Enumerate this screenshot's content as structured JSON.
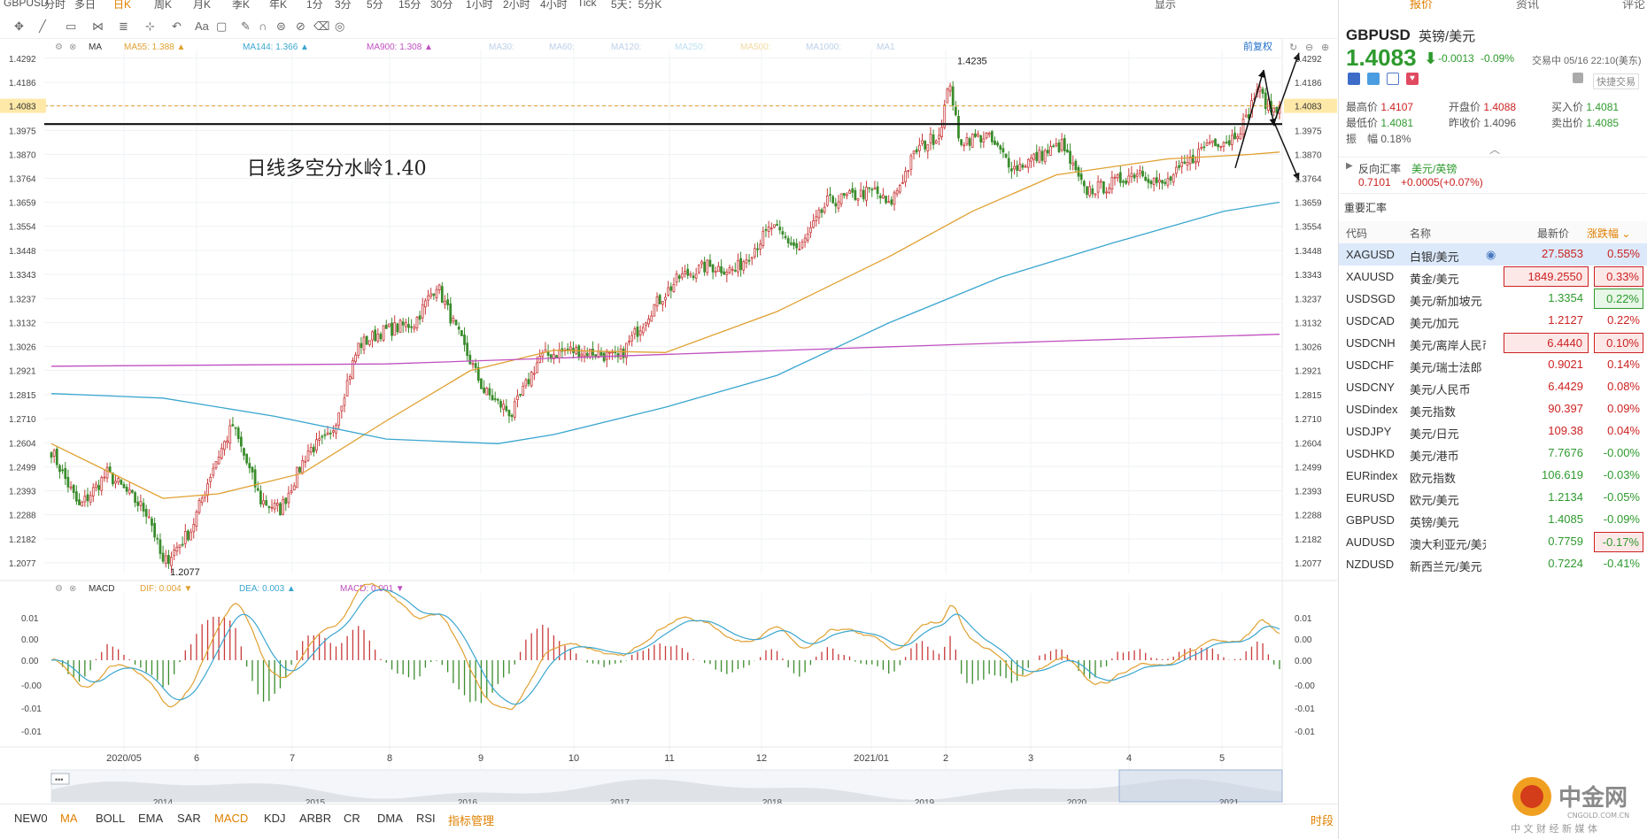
{
  "topbar": {
    "items": [
      "GBPUSD",
      "分时",
      "多日",
      "日K",
      "周K",
      "月K",
      "季K",
      "年K",
      "1分",
      "3分",
      "5分",
      "15分",
      "30分",
      "1小时",
      "2小时",
      "4小时",
      "Tick",
      "5天：5分K"
    ],
    "active_index": 3,
    "right": [
      "显示"
    ]
  },
  "ma_legend": {
    "label": "MA",
    "items": [
      {
        "text": "MA55: 1.388",
        "color": "#e0a030",
        "arrow": "▲"
      },
      {
        "text": "MA144: 1.366",
        "color": "#3aa6cf",
        "arrow": "▲"
      },
      {
        "text": "MA900: 1.308",
        "color": "#c050c0",
        "arrow": "▲"
      },
      {
        "text": "MA30:",
        "color": "#bcd0e8",
        "arrow": ""
      },
      {
        "text": "MA60:",
        "color": "#bcd0e8",
        "arrow": ""
      },
      {
        "text": "MA120:",
        "color": "#bcd0e8",
        "arrow": ""
      },
      {
        "text": "MA250:",
        "color": "#bde0f0",
        "arrow": ""
      },
      {
        "text": "MA500:",
        "color": "#f2d9a0",
        "arrow": ""
      },
      {
        "text": "MA1000:",
        "color": "#bcd0e8",
        "arrow": ""
      },
      {
        "text": "MA1",
        "color": "#bcd0e8",
        "arrow": ""
      }
    ],
    "adjust": "前复权"
  },
  "macd_legend": {
    "label": "MACD",
    "dif": "DIF: 0.004",
    "dea": "DEA: 0.003",
    "macd": "MACD: 0.001",
    "dif_arrow": "▼",
    "dea_arrow": "▲",
    "macd_arrow": "▼"
  },
  "chart_data": {
    "type": "candlestick",
    "symbol": "GBPUSD",
    "ylim": [
      1.203,
      1.433
    ],
    "y_ticks": [
      "1.4292",
      "1.4186",
      "1.4083",
      "1.3975",
      "1.3870",
      "1.3764",
      "1.3659",
      "1.3554",
      "1.3448",
      "1.3343",
      "1.3237",
      "1.3132",
      "1.3026",
      "1.2921",
      "1.2815",
      "1.2710",
      "1.2604",
      "1.2499",
      "1.2393",
      "1.2288",
      "1.2182",
      "1.2077"
    ],
    "x_ticks": [
      "2020/05",
      "6",
      "7",
      "8",
      "9",
      "10",
      "11",
      "12",
      "2021/01",
      "2",
      "3",
      "4",
      "5"
    ],
    "anchors": [
      [
        0,
        1.257
      ],
      [
        10,
        1.232
      ],
      [
        20,
        1.247
      ],
      [
        35,
        1.229
      ],
      [
        40,
        1.207
      ],
      [
        50,
        1.222
      ],
      [
        58,
        1.25
      ],
      [
        65,
        1.268
      ],
      [
        75,
        1.235
      ],
      [
        82,
        1.231
      ],
      [
        92,
        1.257
      ],
      [
        100,
        1.263
      ],
      [
        110,
        1.303
      ],
      [
        118,
        1.309
      ],
      [
        130,
        1.313
      ],
      [
        138,
        1.33
      ],
      [
        145,
        1.31
      ],
      [
        155,
        1.283
      ],
      [
        165,
        1.273
      ],
      [
        175,
        1.298
      ],
      [
        185,
        1.301
      ],
      [
        195,
        1.3
      ],
      [
        203,
        1.297
      ],
      [
        215,
        1.319
      ],
      [
        225,
        1.333
      ],
      [
        235,
        1.338
      ],
      [
        245,
        1.336
      ],
      [
        258,
        1.355
      ],
      [
        268,
        1.345
      ],
      [
        278,
        1.366
      ],
      [
        285,
        1.368
      ],
      [
        295,
        1.371
      ],
      [
        300,
        1.364
      ],
      [
        310,
        1.389
      ],
      [
        318,
        1.396
      ],
      [
        322,
        1.419
      ],
      [
        325,
        1.393
      ],
      [
        335,
        1.395
      ],
      [
        345,
        1.381
      ],
      [
        355,
        1.387
      ],
      [
        362,
        1.391
      ],
      [
        370,
        1.371
      ],
      [
        378,
        1.373
      ],
      [
        390,
        1.38
      ],
      [
        398,
        1.373
      ],
      [
        408,
        1.384
      ],
      [
        415,
        1.393
      ],
      [
        422,
        1.393
      ],
      [
        428,
        1.402
      ],
      [
        432,
        1.416
      ],
      [
        436,
        1.408
      ],
      [
        440,
        1.405
      ]
    ],
    "ma_series": [
      {
        "name": "MA55",
        "color": "#e0a030",
        "pts": [
          [
            0,
            1.26
          ],
          [
            40,
            1.236
          ],
          [
            60,
            1.238
          ],
          [
            90,
            1.247
          ],
          [
            120,
            1.27
          ],
          [
            150,
            1.292
          ],
          [
            180,
            1.301
          ],
          [
            220,
            1.3
          ],
          [
            260,
            1.318
          ],
          [
            300,
            1.342
          ],
          [
            330,
            1.362
          ],
          [
            360,
            1.378
          ],
          [
            400,
            1.385
          ],
          [
            430,
            1.387
          ],
          [
            440,
            1.388
          ]
        ]
      },
      {
        "name": "MA144",
        "color": "#3aa6cf",
        "pts": [
          [
            0,
            1.282
          ],
          [
            40,
            1.28
          ],
          [
            80,
            1.272
          ],
          [
            120,
            1.262
          ],
          [
            160,
            1.26
          ],
          [
            180,
            1.264
          ],
          [
            220,
            1.276
          ],
          [
            260,
            1.29
          ],
          [
            300,
            1.313
          ],
          [
            340,
            1.333
          ],
          [
            380,
            1.348
          ],
          [
            420,
            1.362
          ],
          [
            440,
            1.366
          ]
        ]
      },
      {
        "name": "MA900",
        "color": "#c050c0",
        "pts": [
          [
            0,
            1.294
          ],
          [
            120,
            1.295
          ],
          [
            240,
            1.3
          ],
          [
            360,
            1.305
          ],
          [
            440,
            1.308
          ]
        ]
      }
    ],
    "annotations": [
      {
        "text": "1.4235",
        "at": [
          322,
          1.4235
        ]
      },
      {
        "text": "1.2077",
        "at": [
          40,
          1.2077
        ]
      },
      {
        "text": "日线多空分水岭1.40",
        "at": [
          70,
          1.378
        ]
      }
    ],
    "current_price": 1.4083,
    "key_level": 1.4003,
    "macd": {
      "y_ticks": [
        "0.01",
        "0.00",
        "0.00",
        "-0.00",
        "-0.01",
        "-0.01"
      ],
      "ylim": [
        -0.012,
        0.012
      ]
    },
    "navigator_years": [
      "2014",
      "2015",
      "2016",
      "2017",
      "2018",
      "2019",
      "2020",
      "2021"
    ]
  },
  "indicators": [
    "NEW0",
    "MA",
    "BOLL",
    "EMA",
    "SAR",
    "MACD",
    "KDJ",
    "ARBR",
    "CR",
    "DMA",
    "RSI",
    "指标管理"
  ],
  "indicators_active": [
    "MA",
    "MACD"
  ],
  "indicator_right": "时段",
  "panel": {
    "tabs": [
      "报价",
      "资讯",
      "评论"
    ],
    "symbol": "GBPUSD",
    "name": "英镑/美元",
    "price": "1.4083",
    "change": "-0.0013",
    "change_pct": "-0.09%",
    "status": "交易中 05/16 22:10(美东)",
    "quick_trade": "快捷交易",
    "stats": [
      {
        "label": "最高价",
        "value": "1.4107",
        "cls": "pos"
      },
      {
        "label": "开盘价",
        "value": "1.4088",
        "cls": "pos"
      },
      {
        "label": "买入价",
        "value": "1.4081",
        "cls": "neg"
      },
      {
        "label": "最低价",
        "value": "1.4081",
        "cls": "neg"
      },
      {
        "label": "昨收价",
        "value": "1.4096",
        "cls": ""
      },
      {
        "label": "卖出价",
        "value": "1.4085",
        "cls": "neg"
      },
      {
        "label": "振　幅",
        "value": "0.18%",
        "cls": ""
      }
    ],
    "reverse": {
      "label": "反向汇率",
      "pair": "美元/英镑",
      "price": "0.7101",
      "change": "+0.0005(+0.07%)"
    },
    "section_title": "重要汇率",
    "table_headers": [
      "代码",
      "名称",
      "最新价",
      "涨跌幅"
    ],
    "rows": [
      {
        "code": "XAGUSD",
        "name": "白银/美元",
        "price": "27.5853",
        "pct": "0.55%",
        "dir": "pos",
        "box": "",
        "selected": true
      },
      {
        "code": "XAUUSD",
        "name": "黄金/美元",
        "price": "1849.2550",
        "pct": "0.33%",
        "dir": "pos",
        "box": "pos",
        "selected": false
      },
      {
        "code": "USDSGD",
        "name": "美元/新加坡元",
        "price": "1.3354",
        "pct": "0.22%",
        "dir": "neg",
        "box": "neg-pct",
        "selected": false
      },
      {
        "code": "USDCAD",
        "name": "美元/加元",
        "price": "1.2127",
        "pct": "0.22%",
        "dir": "pos",
        "box": "",
        "selected": false
      },
      {
        "code": "USDCNH",
        "name": "美元/离岸人民币",
        "price": "6.4440",
        "pct": "0.10%",
        "dir": "pos",
        "box": "pos",
        "selected": false
      },
      {
        "code": "USDCHF",
        "name": "美元/瑞士法郎",
        "price": "0.9021",
        "pct": "0.14%",
        "dir": "pos",
        "box": "",
        "selected": false
      },
      {
        "code": "USDCNY",
        "name": "美元/人民币",
        "price": "6.4429",
        "pct": "0.08%",
        "dir": "pos",
        "box": "",
        "selected": false
      },
      {
        "code": "USDindex",
        "name": "美元指数",
        "price": "90.397",
        "pct": "0.09%",
        "dir": "pos",
        "box": "",
        "selected": false
      },
      {
        "code": "USDJPY",
        "name": "美元/日元",
        "price": "109.38",
        "pct": "0.04%",
        "dir": "pos",
        "box": "",
        "selected": false
      },
      {
        "code": "USDHKD",
        "name": "美元/港币",
        "price": "7.7676",
        "pct": "-0.00%",
        "dir": "neg",
        "box": "",
        "selected": false
      },
      {
        "code": "EURindex",
        "name": "欧元指数",
        "price": "106.619",
        "pct": "-0.03%",
        "dir": "neg",
        "box": "",
        "selected": false
      },
      {
        "code": "EURUSD",
        "name": "欧元/美元",
        "price": "1.2134",
        "pct": "-0.05%",
        "dir": "neg",
        "box": "",
        "selected": false
      },
      {
        "code": "GBPUSD",
        "name": "英镑/美元",
        "price": "1.4085",
        "pct": "-0.09%",
        "dir": "neg",
        "box": "",
        "selected": false
      },
      {
        "code": "AUDUSD",
        "name": "澳大利亚元/美元",
        "price": "0.7759",
        "pct": "-0.17%",
        "dir": "neg",
        "box": "neg-red",
        "selected": false
      },
      {
        "code": "NZDUSD",
        "name": "新西兰元/美元",
        "price": "0.7224",
        "pct": "-0.41%",
        "dir": "neg",
        "box": "",
        "selected": false
      }
    ]
  },
  "logo": {
    "text": "中金网",
    "sub": "中 文 财 经 新 媒 体",
    "domain": "CNGOLD.COM.CN"
  }
}
